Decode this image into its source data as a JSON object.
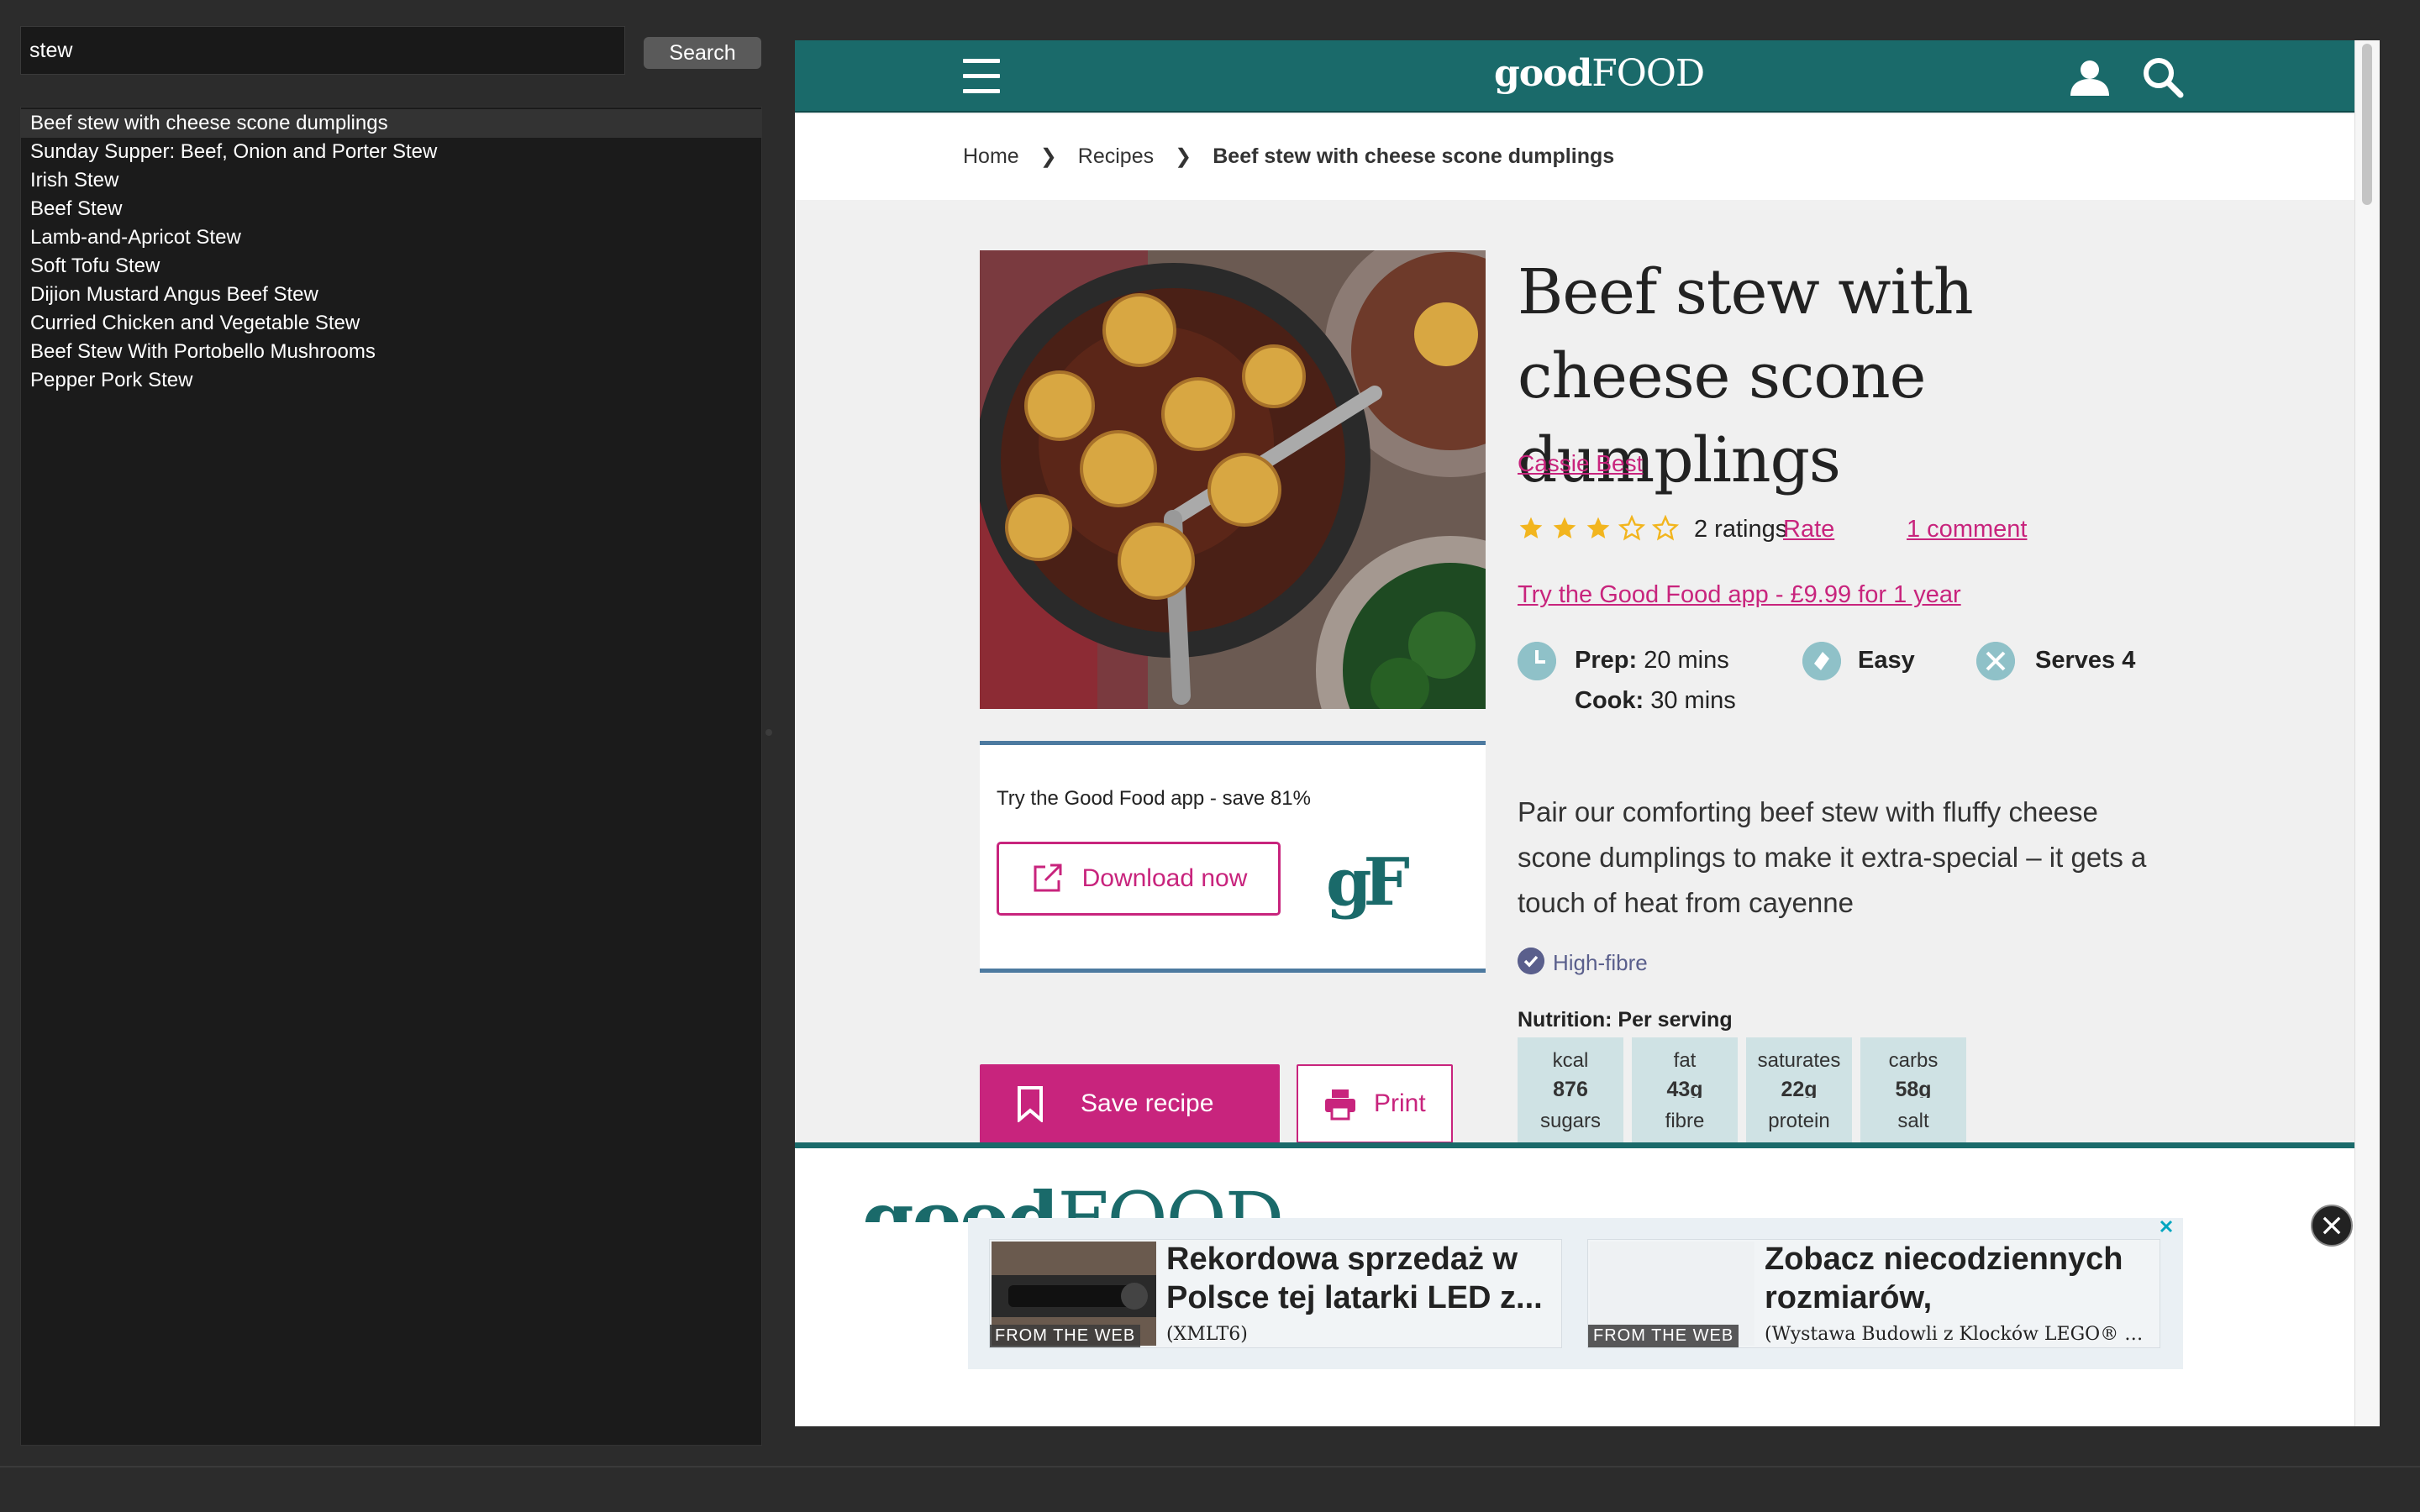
{
  "search": {
    "query": "stew",
    "button_label": "Search",
    "results": [
      "Beef stew with cheese scone dumplings",
      "Sunday Supper: Beef, Onion and Porter Stew",
      "Irish Stew",
      "Beef Stew",
      "Lamb-and-Apricot Stew",
      "Soft Tofu Stew",
      "Dijion Mustard Angus Beef Stew",
      "Curried Chicken and Vegetable Stew",
      "Beef Stew With Portobello Mushrooms",
      "Pepper Pork Stew"
    ],
    "selected_index": 0
  },
  "site": {
    "logo_good": "good",
    "logo_food": "FOOD",
    "brand_color": "#1a6a6a",
    "accent_color": "#c8247d",
    "icons": [
      "menu-icon",
      "user-icon",
      "search-icon"
    ]
  },
  "breadcrumb": [
    "Home",
    "Recipes",
    "Beef stew with cheese scone dumplings"
  ],
  "recipe": {
    "title": "Beef stew with cheese scone dumplings",
    "author": "Cassie Best",
    "rating_stars": 3,
    "rating_max": 5,
    "ratings_text": "2 ratings",
    "rate_label": "Rate",
    "comment_label": "1 comment",
    "app_offer": "Try the Good Food app - £9.99 for 1 year",
    "prep_label": "Prep:",
    "prep_value": "20 mins",
    "cook_label": "Cook:",
    "cook_value": "30 mins",
    "difficulty": "Easy",
    "serves": "Serves 4",
    "description": "Pair our comforting beef stew with fluffy cheese scone dumplings to make it extra-special – it gets a touch of heat from cayenne",
    "badge": "High-fibre",
    "nutrition_heading": "Nutrition: Per serving",
    "nutrition": [
      {
        "label": "kcal",
        "value": "876"
      },
      {
        "label": "fat",
        "value": "43g"
      },
      {
        "label": "saturates",
        "value": "22g"
      },
      {
        "label": "carbs",
        "value": "58g"
      },
      {
        "label": "sugars",
        "value": ""
      },
      {
        "label": "fibre",
        "value": ""
      },
      {
        "label": "protein",
        "value": ""
      },
      {
        "label": "salt",
        "value": ""
      }
    ]
  },
  "promo": {
    "text": "Try the Good Food app - save 81%",
    "download_label": "Download now",
    "app_logo": "gF"
  },
  "actions": {
    "save_label": "Save recipe",
    "print_label": "Print"
  },
  "ad": {
    "logo_good": "good",
    "logo_food": "FOOD",
    "cards": [
      {
        "source": "FROM THE WEB",
        "title": "Rekordowa sprzedaż w Polsce tej latarki LED z...",
        "brand": "(XMLT6)"
      },
      {
        "source": "FROM THE WEB",
        "title": "Zobacz niecodziennych rozmiarów, gigantyczne...",
        "brand": "(Wystawa Budowli z Klocków LEGO® Rz..."
      }
    ]
  }
}
